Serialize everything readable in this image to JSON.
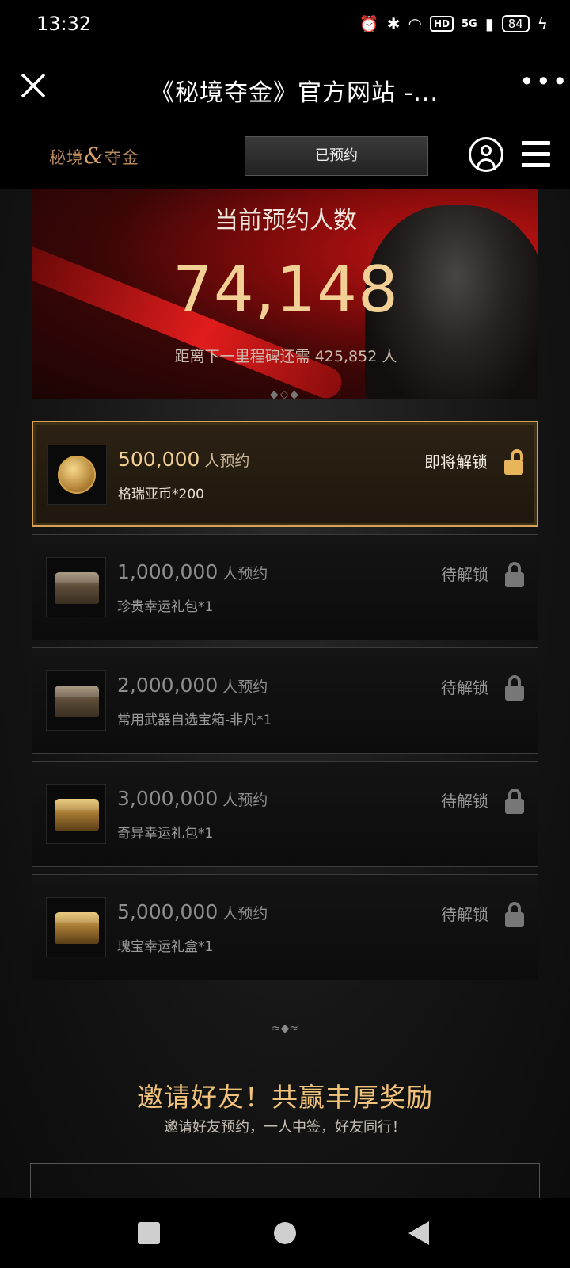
{
  "status_bar": {
    "time": "13:32",
    "hd_label": "HD",
    "network_label": "5G",
    "battery": "84"
  },
  "title_bar": {
    "title": "《秘境夺金》官方网站 -..."
  },
  "site_header": {
    "logo_left": "秘境",
    "logo_amp": "&",
    "logo_right": "夺金",
    "reserved_button": "已预约"
  },
  "hero": {
    "label": "当前预约人数",
    "count": "74,148",
    "remaining_text": "距离下一里程碑还需 425,852 人"
  },
  "milestones": [
    {
      "target": "500,000",
      "unit": "人预约",
      "reward": "格瑞亚币*200",
      "status": "即将解锁",
      "icon": "coin-icon",
      "locked": false
    },
    {
      "target": "1,000,000",
      "unit": "人预约",
      "reward": "珍贵幸运礼包*1",
      "status": "待解锁",
      "icon": "treasure-chest-icon",
      "locked": true
    },
    {
      "target": "2,000,000",
      "unit": "人预约",
      "reward": "常用武器自选宝箱-非凡*1",
      "status": "待解锁",
      "icon": "weapon-chest-icon",
      "locked": true
    },
    {
      "target": "3,000,000",
      "unit": "人预约",
      "reward": "奇异幸运礼包*1",
      "status": "待解锁",
      "icon": "gold-chest-icon",
      "locked": true
    },
    {
      "target": "5,000,000",
      "unit": "人预约",
      "reward": "瑰宝幸运礼盒*1",
      "status": "待解锁",
      "icon": "gold-chest-icon",
      "locked": true
    }
  ],
  "invite": {
    "title": "邀请好友！共赢丰厚奖励",
    "subtitle": "邀请好友预约，一人中签，好友同行！"
  },
  "colors": {
    "accent_gold": "#f2cf94",
    "active_border": "#d7a253",
    "hero_red": "#c81414"
  }
}
